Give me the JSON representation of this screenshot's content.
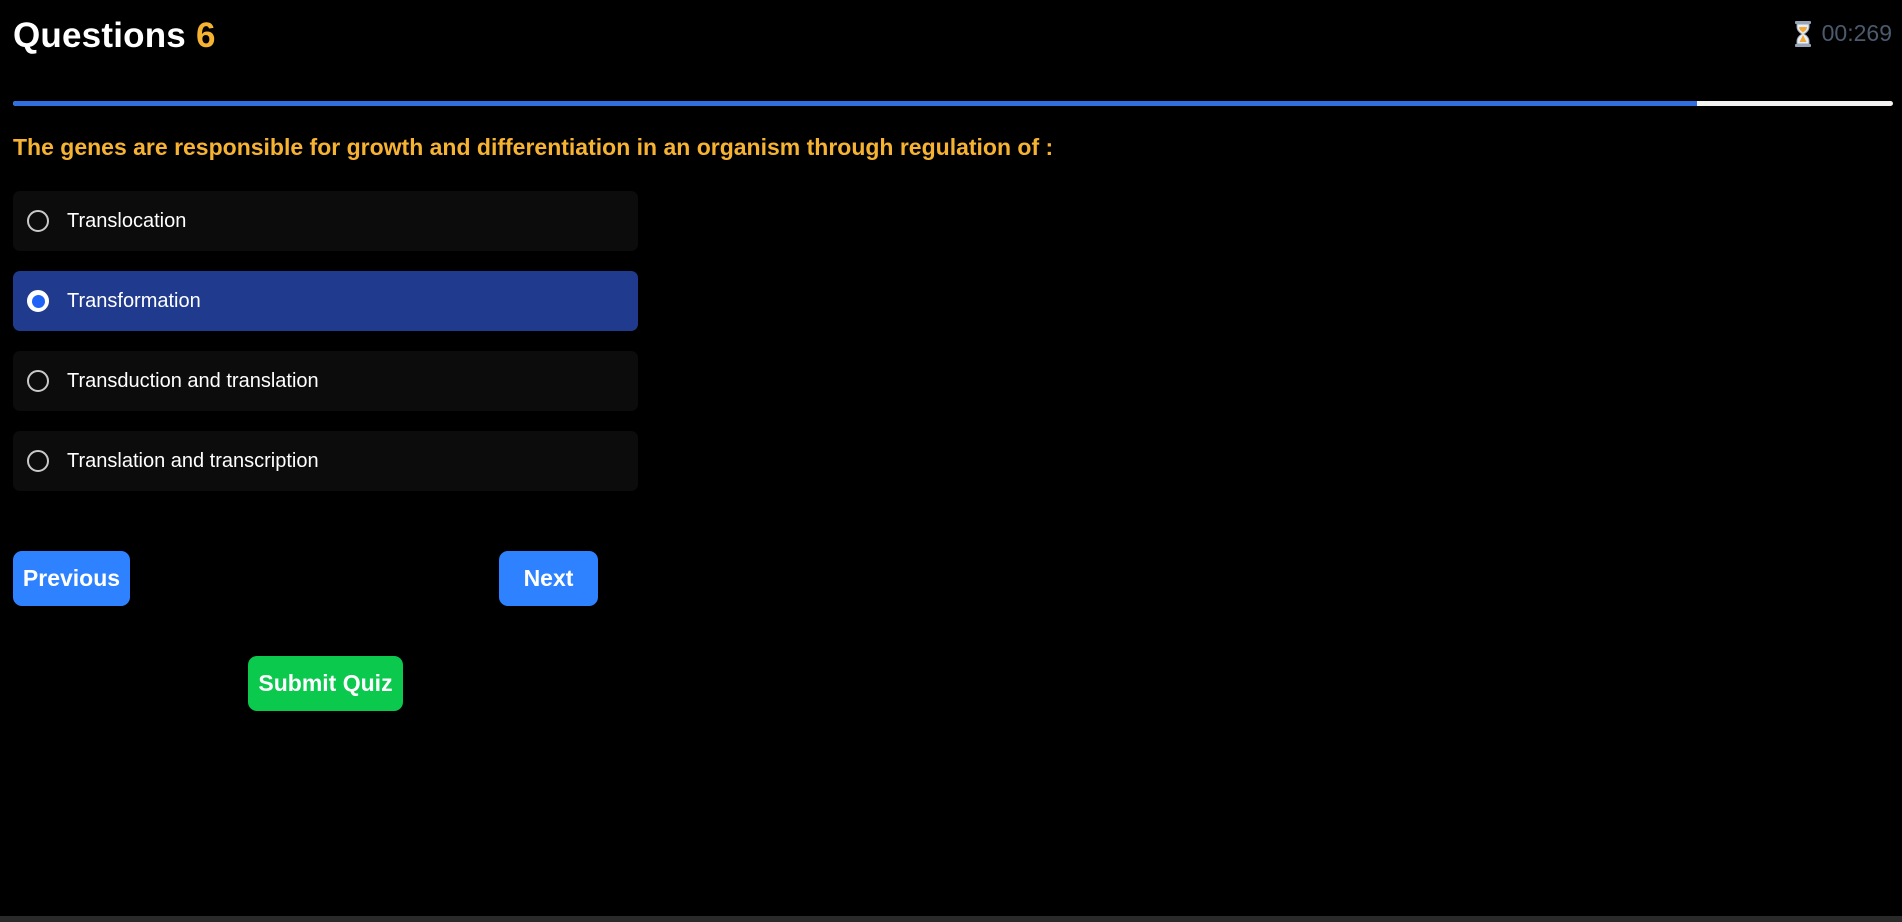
{
  "header": {
    "title": "Questions",
    "question_number": "6"
  },
  "timer": {
    "icon": "hourglass-icon",
    "value": "00:269"
  },
  "progress": {
    "fraction": 0.896
  },
  "question": {
    "text": "The genes are responsible for growth and differentiation in an organism through regulation of :"
  },
  "options": [
    {
      "label": "Translocation",
      "selected": false
    },
    {
      "label": "Transformation",
      "selected": true
    },
    {
      "label": "Transduction and translation",
      "selected": false
    },
    {
      "label": "Translation and transcription",
      "selected": false
    }
  ],
  "buttons": {
    "previous": "Previous",
    "next": "Next",
    "submit": "Submit Quiz"
  },
  "colors": {
    "background": "#000000",
    "accent_yellow": "#f6b332",
    "progress_blue": "#2f6fe0",
    "selected_option": "#203a8d",
    "nav_button": "#2f82ff",
    "submit_button": "#0bc94d"
  }
}
